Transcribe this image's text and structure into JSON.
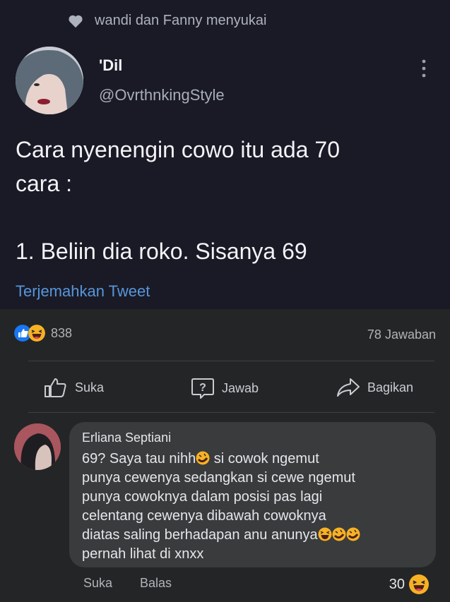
{
  "tweet": {
    "liked_by": "wandi dan Fanny menyukai",
    "name": "'Dil",
    "handle": "@OvrthnkingStyle",
    "text": "Cara nyenengin cowo itu ada 70\ncara :\n\n1. Beliin dia roko. Sisanya 69",
    "translate": "Terjemahkan Tweet"
  },
  "post": {
    "reaction_count": "838",
    "answers": "78 Jawaban",
    "actions": {
      "like": "Suka",
      "answer": "Jawab",
      "share": "Bagikan"
    }
  },
  "comment": {
    "author": "Erliana Septiani",
    "line1_a": "69?  Saya tau nihh",
    "line1_b": " si cowok ngemut",
    "rest_a": "punya cewenya sedangkan si cewe ngemut\npunya cowoknya dalam posisi pas lagi\ncelentang cewenya dibawah cowoknya\ndiatas saling berhadapan anu anunya",
    "rest_b": "\npernah lihat di xnxx",
    "like": "Suka",
    "reply": "Balas",
    "reaction_count": "30"
  },
  "colors": {
    "twitter_bg": "#191a26",
    "link": "#5896da",
    "fb_bg": "#242526",
    "bubble": "#3a3b3c"
  },
  "icons": [
    "heart-icon",
    "more-icon",
    "like-reaction-icon",
    "haha-reaction-icon",
    "thumb-up-icon",
    "question-icon",
    "share-icon",
    "laughing-emoji-icon",
    "rofl-emoji-icon"
  ]
}
